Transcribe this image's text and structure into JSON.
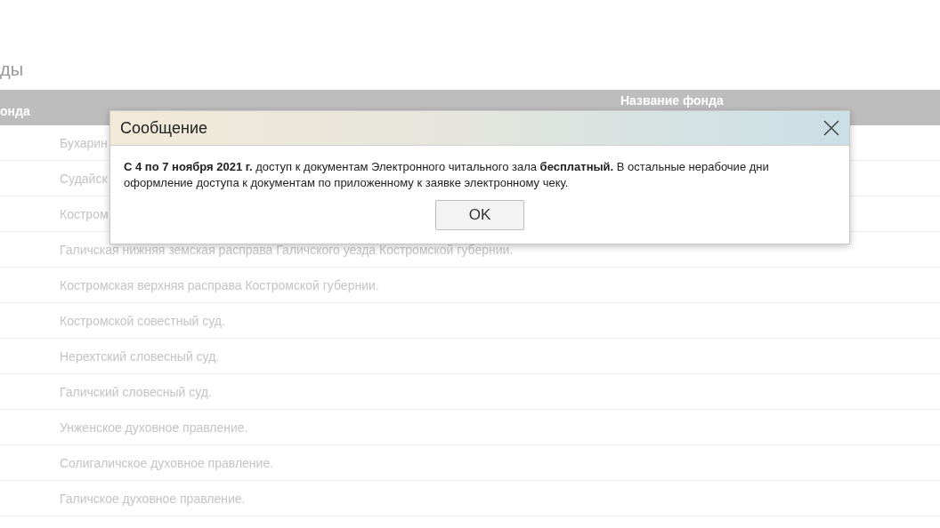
{
  "page": {
    "heading": "ды"
  },
  "table": {
    "columns": [
      "онда",
      "Название фонда"
    ],
    "rows": [
      {
        "name": "Бухарин"
      },
      {
        "name": "Судайск"
      },
      {
        "name": "Костром"
      },
      {
        "name": "Галичская нижняя земская расправа Галичского уезда Костромской губернии."
      },
      {
        "name": "Костромская верхняя расправа Костромской губернии."
      },
      {
        "name": "Костромской совестный суд."
      },
      {
        "name": "Нерехтский словесный суд."
      },
      {
        "name": "Галичский словесный суд."
      },
      {
        "name": "Унженское духовное правление."
      },
      {
        "name": "Солигаличское духовное правление."
      },
      {
        "name": "Галичское духовное правление."
      }
    ]
  },
  "dialog": {
    "title": "Сообщение",
    "message": "**С 4 по 7 ноября 2021 г.** доступ к документам Электронного читального зала **бесплатный.** В остальные нерабочие дни оформление доступа к документам по приложенному к заявке электронному чеку.",
    "button": "OK"
  }
}
